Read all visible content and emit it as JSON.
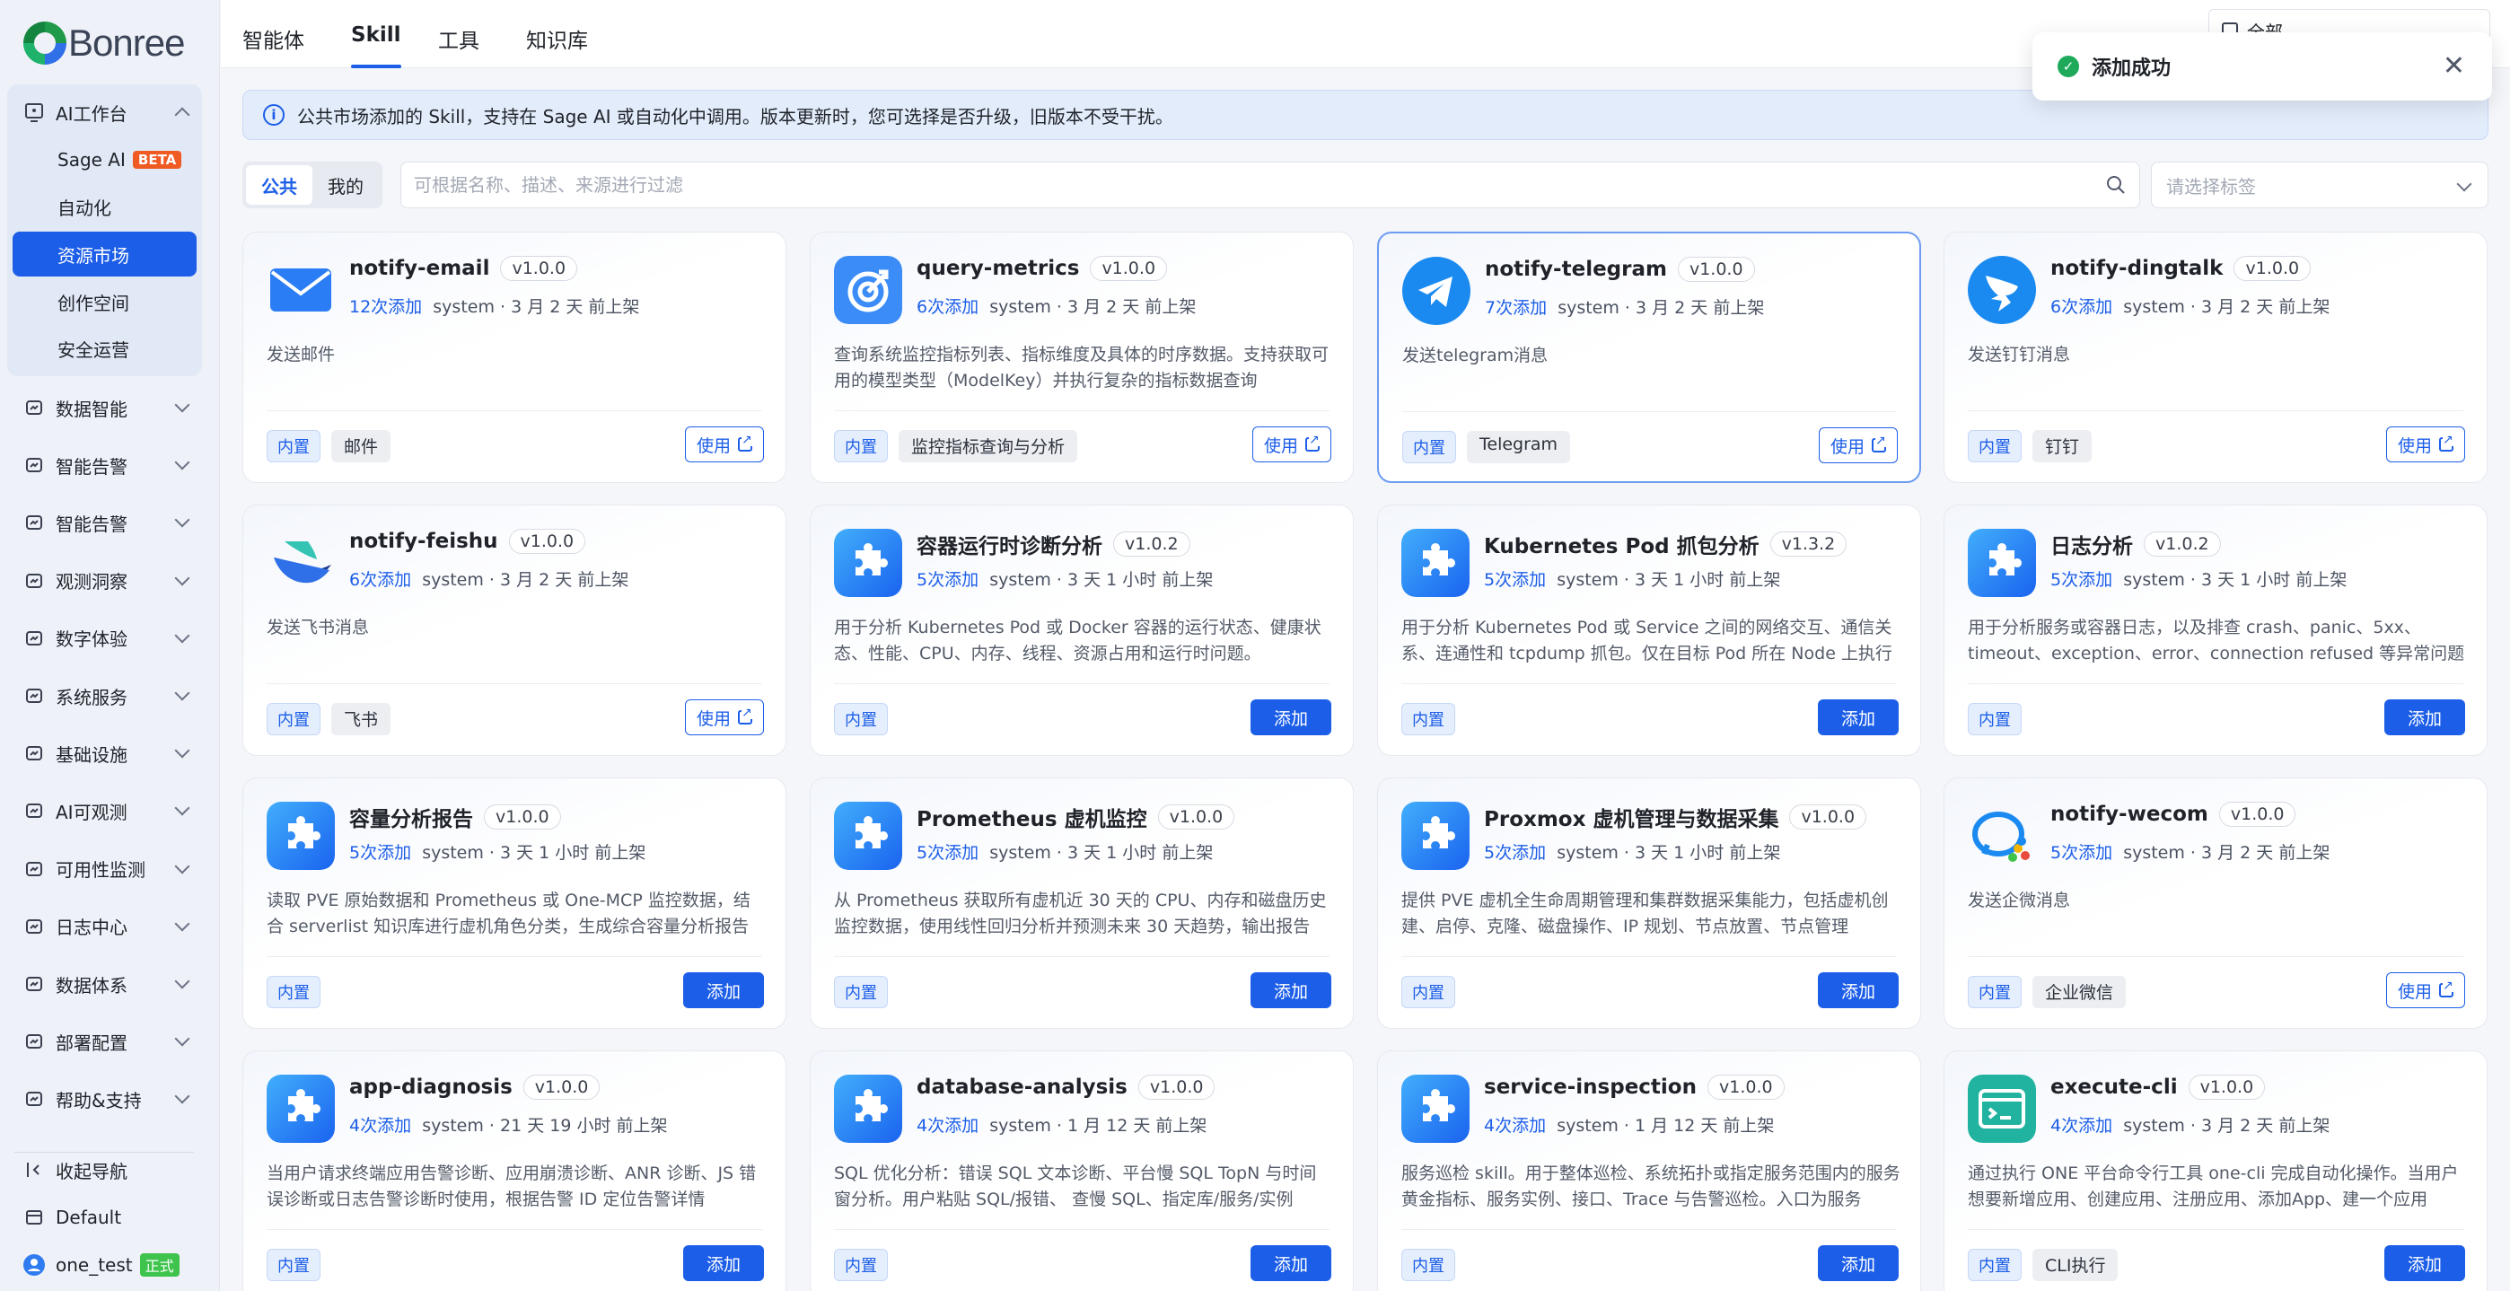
{
  "brand": "Bonree",
  "sidebar": {
    "ai_workspace": "AI工作台",
    "sub_items": [
      "Sage AI",
      "自动化",
      "资源市场",
      "创作空间",
      "安全运营"
    ],
    "beta": "BETA",
    "items": [
      "数据智能",
      "智能告警",
      "智能告警",
      "观测洞察",
      "数字体验",
      "系统服务",
      "基础设施",
      "AI可观测",
      "可用性监测",
      "日志中心",
      "数据体系",
      "部署配置",
      "帮助&支持"
    ],
    "collapse": "收起导航",
    "workspace": "Default",
    "user": "one_test",
    "user_badge": "正式"
  },
  "tabs": [
    "智能体",
    "Skill",
    "工具",
    "知识库"
  ],
  "top_select": "全部",
  "info": "公共市场添加的 Skill，支持在 Sage AI 或自动化中调用。版本更新时，您可选择是否升级，旧版本不受干扰。",
  "segments": [
    "公共",
    "我的"
  ],
  "search": {
    "placeholder": "可根据名称、描述、来源进行过滤"
  },
  "tag_select": {
    "placeholder": "请选择标签"
  },
  "toast": "添加成功",
  "builtin": "内置",
  "use_label": "使用",
  "add_label": "添加",
  "cards": [
    {
      "name": "notify-email",
      "version": "v1.0.0",
      "count": "12次添加",
      "meta": "system · 3 月 2 天 前上架",
      "desc": "发送邮件",
      "tag": "邮件",
      "action": "use",
      "icon": "mail-icon"
    },
    {
      "name": "query-metrics",
      "version": "v1.0.0",
      "count": "6次添加",
      "meta": "system · 3 月 2 天 前上架",
      "desc": "查询系统监控指标列表、指标维度及具体的时序数据。支持获取可用的模型类型（ModelKey）并执行复杂的指标数据查询",
      "tag": "监控指标查询与分析",
      "action": "use",
      "icon": "target-icon"
    },
    {
      "name": "notify-telegram",
      "version": "v1.0.0",
      "count": "7次添加",
      "meta": "system · 3 月 2 天 前上架",
      "desc": "发送telegram消息",
      "tag": "Telegram",
      "action": "use",
      "icon": "telegram-icon"
    },
    {
      "name": "notify-dingtalk",
      "version": "v1.0.0",
      "count": "6次添加",
      "meta": "system · 3 月 2 天 前上架",
      "desc": "发送钉钉消息",
      "tag": "钉钉",
      "action": "use",
      "icon": "dingtalk-icon"
    },
    {
      "name": "notify-feishu",
      "version": "v1.0.0",
      "count": "6次添加",
      "meta": "system · 3 月 2 天 前上架",
      "desc": "发送飞书消息",
      "tag": "飞书",
      "action": "use",
      "icon": "feishu-icon"
    },
    {
      "name": "容器运行时诊断分析",
      "version": "v1.0.2",
      "count": "5次添加",
      "meta": "system · 3 天 1 小时 前上架",
      "desc": "用于分析 Kubernetes Pod 或 Docker 容器的运行状态、健康状态、性能、CPU、内存、线程、资源占用和运行时问题。",
      "tag": "",
      "action": "add",
      "icon": "puzzle-icon"
    },
    {
      "name": "Kubernetes Pod 抓包分析",
      "version": "v1.3.2",
      "count": "5次添加",
      "meta": "system · 3 天 1 小时 前上架",
      "desc": "用于分析 Kubernetes Pod 或 Service 之间的网络交互、通信关系、连通性和 tcpdump 抓包。仅在目标 Pod 所在 Node 上执行",
      "tag": "",
      "action": "add",
      "icon": "puzzle-icon"
    },
    {
      "name": "日志分析",
      "version": "v1.0.2",
      "count": "5次添加",
      "meta": "system · 3 天 1 小时 前上架",
      "desc": "用于分析服务或容器日志，以及排查 crash、panic、5xx、timeout、exception、error、connection refused 等异常问题",
      "tag": "",
      "action": "add",
      "icon": "puzzle-icon"
    },
    {
      "name": "容量分析报告",
      "version": "v1.0.0",
      "count": "5次添加",
      "meta": "system · 3 天 1 小时 前上架",
      "desc": "读取 PVE 原始数据和 Prometheus 或 One-MCP 监控数据，结合 serverlist 知识库进行虚机角色分类，生成综合容量分析报告",
      "tag": "",
      "action": "add",
      "icon": "puzzle-icon"
    },
    {
      "name": "Prometheus 虚机监控",
      "version": "v1.0.0",
      "count": "5次添加",
      "meta": "system · 3 天 1 小时 前上架",
      "desc": "从 Prometheus 获取所有虚机近 30 天的 CPU、内存和磁盘历史监控数据，使用线性回归分析并预测未来 30 天趋势，输出报告",
      "tag": "",
      "action": "add",
      "icon": "puzzle-icon"
    },
    {
      "name": "Proxmox 虚机管理与数据采集",
      "version": "v1.0.0",
      "count": "5次添加",
      "meta": "system · 3 天 1 小时 前上架",
      "desc": "提供 PVE 虚机全生命周期管理和集群数据采集能力，包括虚机创建、启停、克隆、磁盘操作、IP 规划、节点放置、节点管理",
      "tag": "",
      "action": "add",
      "icon": "puzzle-icon"
    },
    {
      "name": "notify-wecom",
      "version": "v1.0.0",
      "count": "5次添加",
      "meta": "system · 3 月 2 天 前上架",
      "desc": "发送企微消息",
      "tag": "企业微信",
      "action": "use",
      "icon": "wecom-icon"
    },
    {
      "name": "app-diagnosis",
      "version": "v1.0.0",
      "count": "4次添加",
      "meta": "system · 21 天 19 小时 前上架",
      "desc": "当用户请求终端应用告警诊断、应用崩溃诊断、ANR 诊断、JS 错误诊断或日志告警诊断时使用，根据告警 ID 定位告警详情",
      "tag": "",
      "action": "add",
      "icon": "puzzle-icon"
    },
    {
      "name": "database-analysis",
      "version": "v1.0.0",
      "count": "4次添加",
      "meta": "system · 1 月 12 天 前上架",
      "desc": "SQL 优化分析：错误 SQL 文本诊断、平台慢 SQL TopN 与时间窗分析。用户粘贴 SQL/报错、 查慢 SQL、指定库/服务/实例",
      "tag": "",
      "action": "add",
      "icon": "puzzle-icon"
    },
    {
      "name": "service-inspection",
      "version": "v1.0.0",
      "count": "4次添加",
      "meta": "system · 1 月 12 天 前上架",
      "desc": "服务巡检 skill。用于整体巡检、系统拓扑或指定服务范围内的服务黄金指标、服务实例、接口、Trace 与告警巡检。入口为服务",
      "tag": "",
      "action": "add",
      "icon": "puzzle-icon"
    },
    {
      "name": "execute-cli",
      "version": "v1.0.0",
      "count": "4次添加",
      "meta": "system · 3 月 2 天 前上架",
      "desc": "通过执行 ONE 平台命令行工具 one-cli 完成自动化操作。当用户想要新增应用、创建应用、注册应用、添加App、建一个应用",
      "tag": "CLI执行",
      "action": "add",
      "icon": "terminal-icon"
    }
  ]
}
